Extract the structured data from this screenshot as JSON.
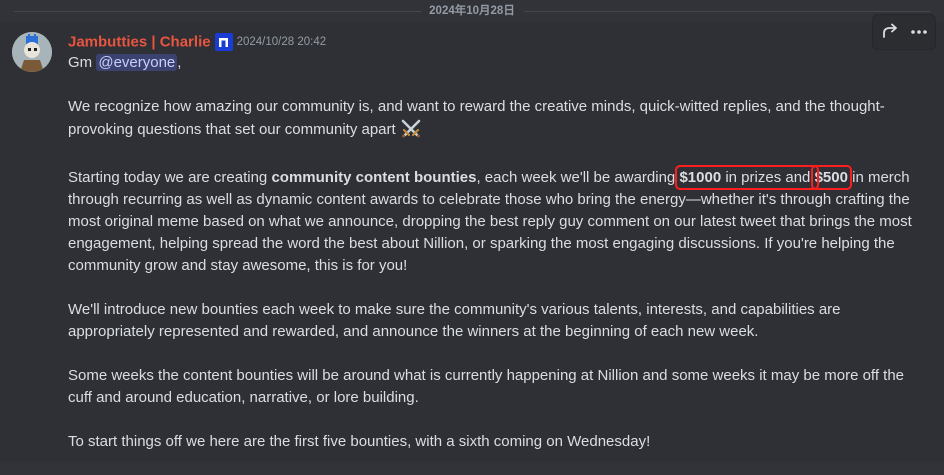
{
  "date_divider": "2024年10月28日",
  "message": {
    "author": "Jambutties | Charlie",
    "timestamp": "2024/10/28 20:42",
    "greeting_prefix": "Gm ",
    "mention": "@everyone",
    "greeting_suffix": ",",
    "para1": "We recognize how amazing our community is, and want to reward the creative minds, quick-witted replies, and the thought-provoking questions that set our community apart",
    "para2_a": "Starting today we are creating ",
    "para2_bold": "community content bounties",
    "para2_b": ", each week we'll be awarding ",
    "prize_amount": "$1000",
    "para2_c": " in prizes and ",
    "merch_amount": "$500",
    "para2_d": " in merch through recurring as well as dynamic content awards to celebrate those who bring the energy—whether it's through crafting the most original meme based on what we announce, dropping the best reply guy comment on our latest tweet that brings the most engagement, helping spread the word the best about Nillion, or sparking the most engaging discussions. If you're helping the community grow and stay awesome, this is for you!",
    "para3": "We'll introduce new bounties each week to make sure the community's various talents, interests, and capabilities are appropriately represented and rewarded, and announce the winners at the beginning of each new week.",
    "para4": "Some weeks the content bounties will be around what is currently happening at Nillion and some weeks it may be more off the cuff and around education, narrative, or lore building.",
    "para5": "To start things off we here are the first five bounties, with a sixth coming on Wednesday!"
  },
  "icons": {
    "emoji": "crossed-swords-icon",
    "badge": "app-badge-icon",
    "forward": "forward-icon",
    "more": "more-icon"
  },
  "colors": {
    "username": "#e9553f",
    "mention_bg": "#3c4270",
    "highlight_box": "#ff1e1e",
    "badge": "#1a3cd6"
  }
}
